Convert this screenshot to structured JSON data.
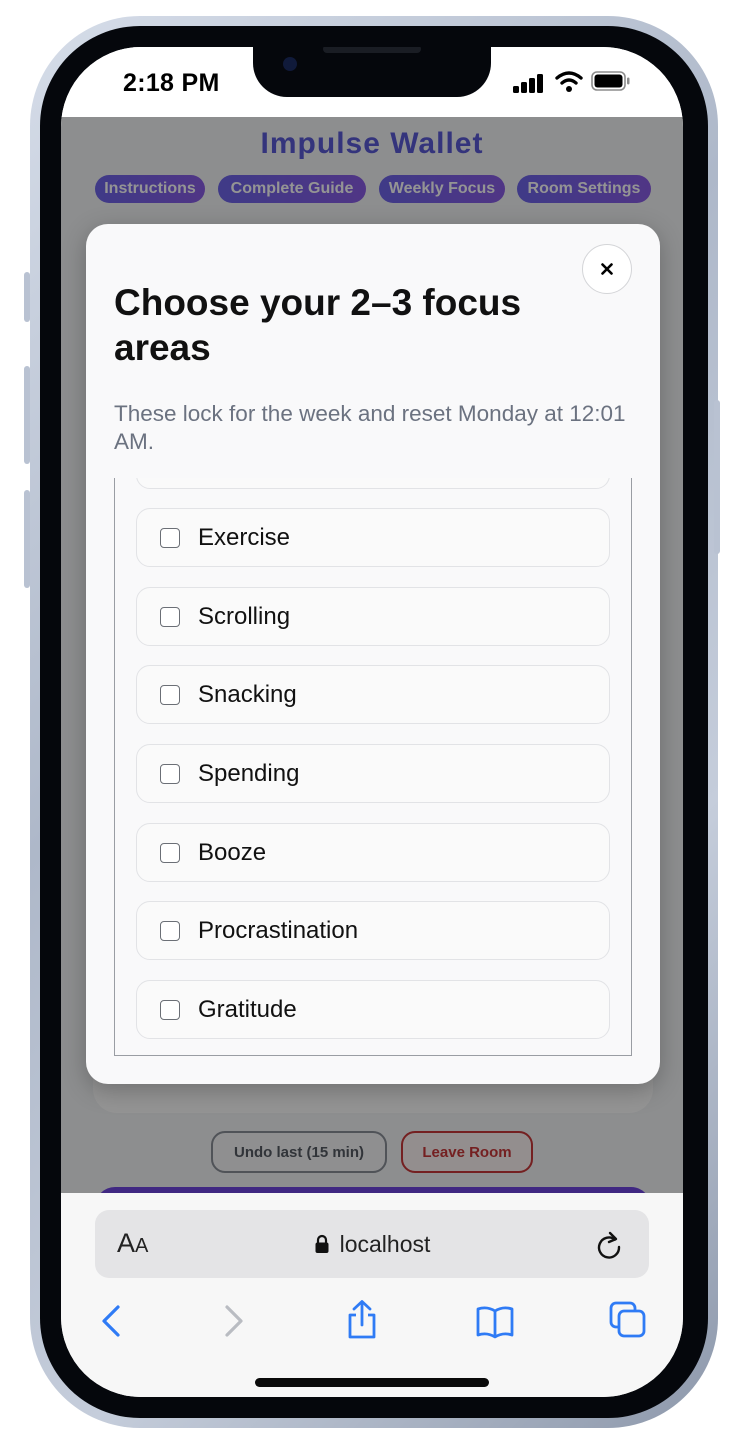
{
  "status_bar": {
    "time": "2:18 PM"
  },
  "app": {
    "title": "Impulse Wallet",
    "nav": [
      {
        "label": "Instructions"
      },
      {
        "label": "Complete Guide"
      },
      {
        "label": "Weekly Focus"
      },
      {
        "label": "Room Settings"
      }
    ],
    "undo_label": "Undo last (15 min)",
    "leave_label": "Leave Room",
    "accent_color": "#5b5bd6",
    "danger_color": "#c8373a"
  },
  "modal": {
    "title": "Choose your 2–3 focus areas",
    "subtitle": "These lock for the week and reset Monday at 12:01 AM.",
    "close_label": "×",
    "options": [
      {
        "label": "Exercise",
        "checked": false
      },
      {
        "label": "Scrolling",
        "checked": false
      },
      {
        "label": "Snacking",
        "checked": false
      },
      {
        "label": "Spending",
        "checked": false
      },
      {
        "label": "Booze",
        "checked": false
      },
      {
        "label": "Procrastination",
        "checked": false
      },
      {
        "label": "Gratitude",
        "checked": false
      }
    ]
  },
  "browser": {
    "text_size_big": "A",
    "text_size_small": "A",
    "url": "localhost",
    "icons": [
      "back-icon",
      "forward-icon",
      "share-icon",
      "bookmarks-icon",
      "tabs-icon",
      "reload-icon",
      "lock-icon"
    ]
  }
}
